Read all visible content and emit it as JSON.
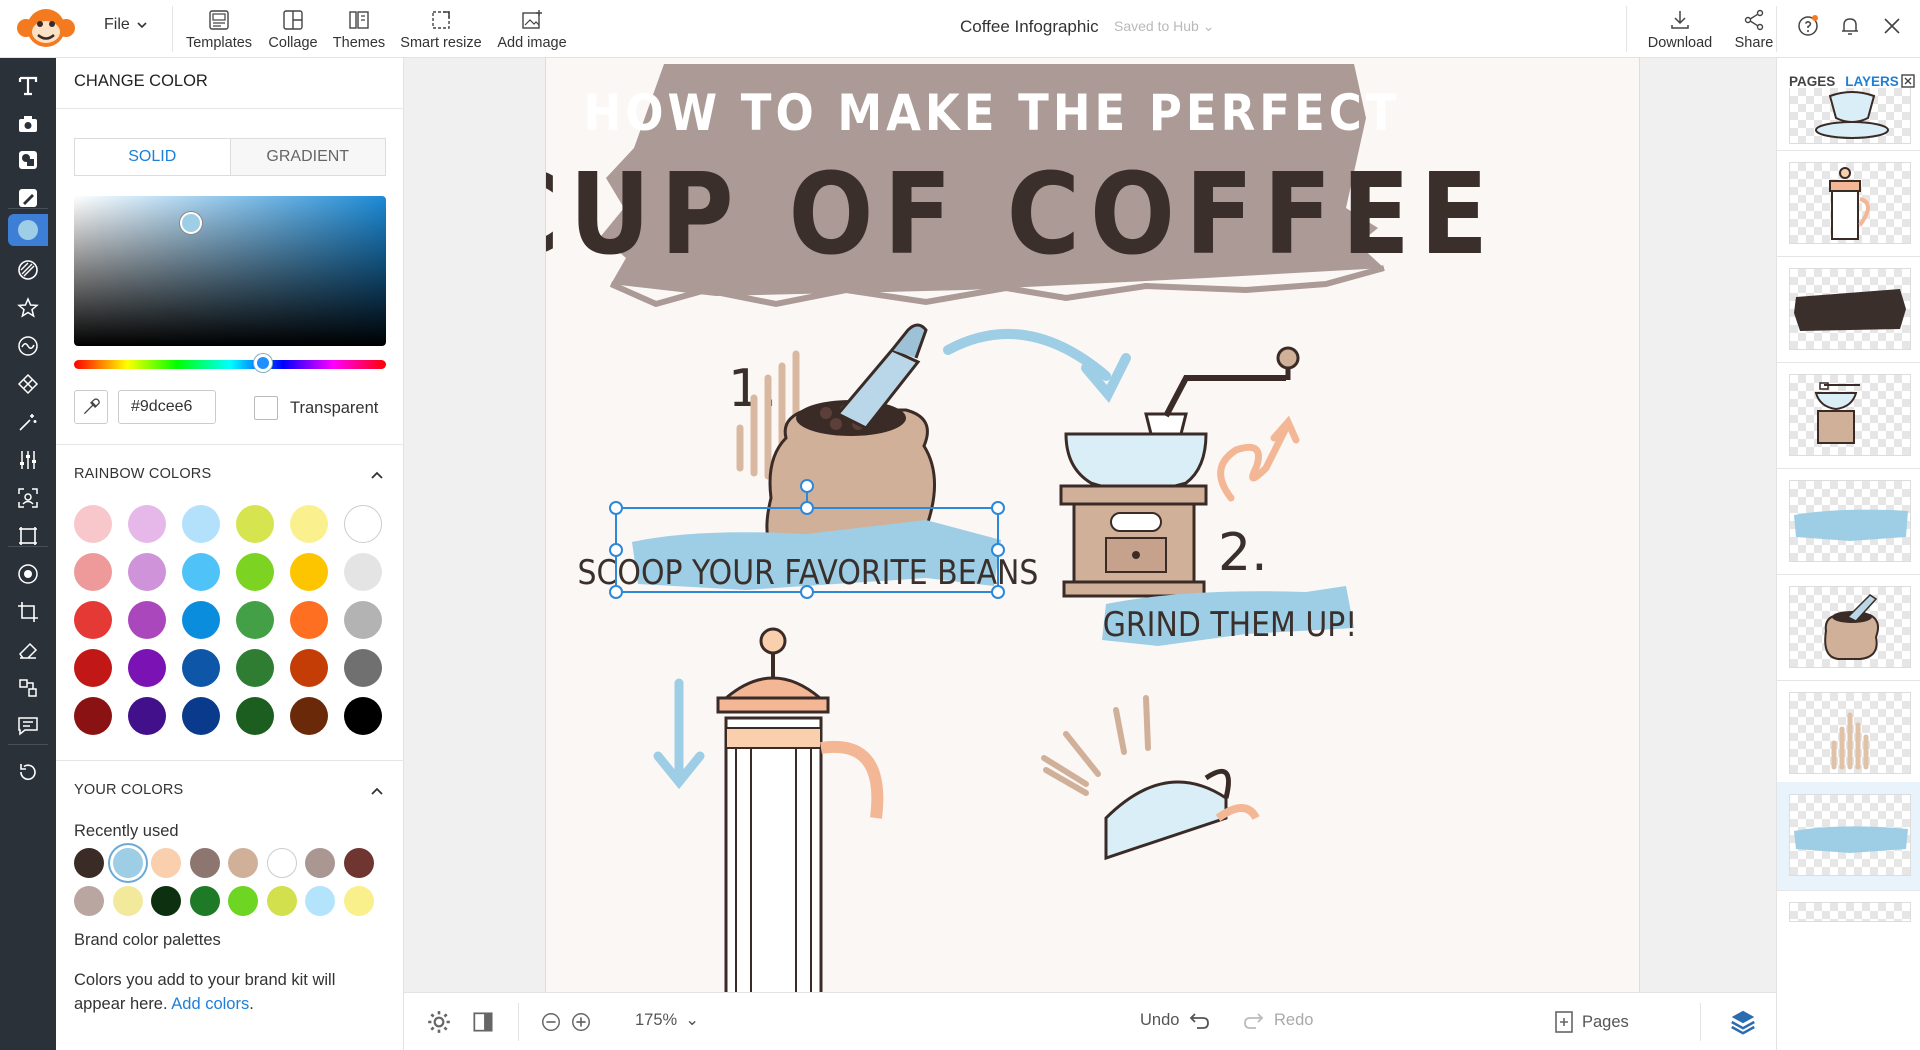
{
  "topbar": {
    "file_label": "File",
    "tools": [
      {
        "label": "Templates",
        "icon": "templates-icon"
      },
      {
        "label": "Collage",
        "icon": "collage-icon"
      },
      {
        "label": "Themes",
        "icon": "themes-icon"
      },
      {
        "label": "Smart resize",
        "icon": "smart-resize-icon"
      },
      {
        "label": "Add image",
        "icon": "add-image-icon"
      }
    ],
    "doc_title": "Coffee Infographic",
    "save_status": "Saved to Hub",
    "download_label": "Download",
    "share_label": "Share"
  },
  "panel": {
    "title": "CHANGE COLOR",
    "tab_solid": "SOLID",
    "tab_gradient": "GRADIENT",
    "hex_value": "#9dcee6",
    "transparent_label": "Transparent",
    "rainbow_title": "RAINBOW COLORS",
    "rainbow_colors": [
      "#f8c7cc",
      "#e6b8ea",
      "#b3e1fb",
      "#d6e44f",
      "#fbf08e",
      "#ffffff",
      "#ef9a9a",
      "#ce93d8",
      "#4fc3f7",
      "#7cd321",
      "#fdc500",
      "#e4e4e4",
      "#e53935",
      "#ab47bc",
      "#0a8ddc",
      "#43a047",
      "#ff6f22",
      "#b3b3b3",
      "#c21717",
      "#7b12b3",
      "#0d56a8",
      "#2e7d32",
      "#c43c06",
      "#707070",
      "#8b1212",
      "#42108a",
      "#0a3a8c",
      "#1b5e20",
      "#6a2a0a",
      "#000000"
    ],
    "your_colors_title": "YOUR COLORS",
    "recently_used_label": "Recently used",
    "recent_colors": [
      "#3a2b26",
      "#9dcee6",
      "#f9cfae",
      "#8d7670",
      "#d1b09a",
      "#ffffff",
      "#aa9792",
      "#6e3531",
      "#b9a6a0",
      "#f2e99d",
      "#0d3010",
      "#1e7a26",
      "#6ed522",
      "#d1e04c",
      "#b3e4fb",
      "#f9f08c"
    ],
    "brand_label": "Brand color palettes",
    "brand_text": "Colors you add to your brand kit will appear here.",
    "add_colors_link": "Add colors"
  },
  "canvas": {
    "headline_1": "HOW TO MAKE THE PERFECT",
    "headline_2": "CUP OF COFFEE",
    "step1_number": "1.",
    "step1_text": "SCOOP YOUR FAVORITE BEANS",
    "step2_number": "2.",
    "step2_text": "GRIND THEM UP!",
    "colors": {
      "banner": "#ab9a96",
      "headline_dark": "#3a2f2b",
      "accent_blue": "#9dcee6",
      "peach": "#f4b795",
      "page_bg": "#fbf7f5"
    }
  },
  "bottombar": {
    "zoom": "175%",
    "undo_label": "Undo",
    "redo_label": "Redo",
    "pages_label": "Pages"
  },
  "rightpanel": {
    "tab_pages": "PAGES",
    "tab_layers": "LAYERS"
  }
}
